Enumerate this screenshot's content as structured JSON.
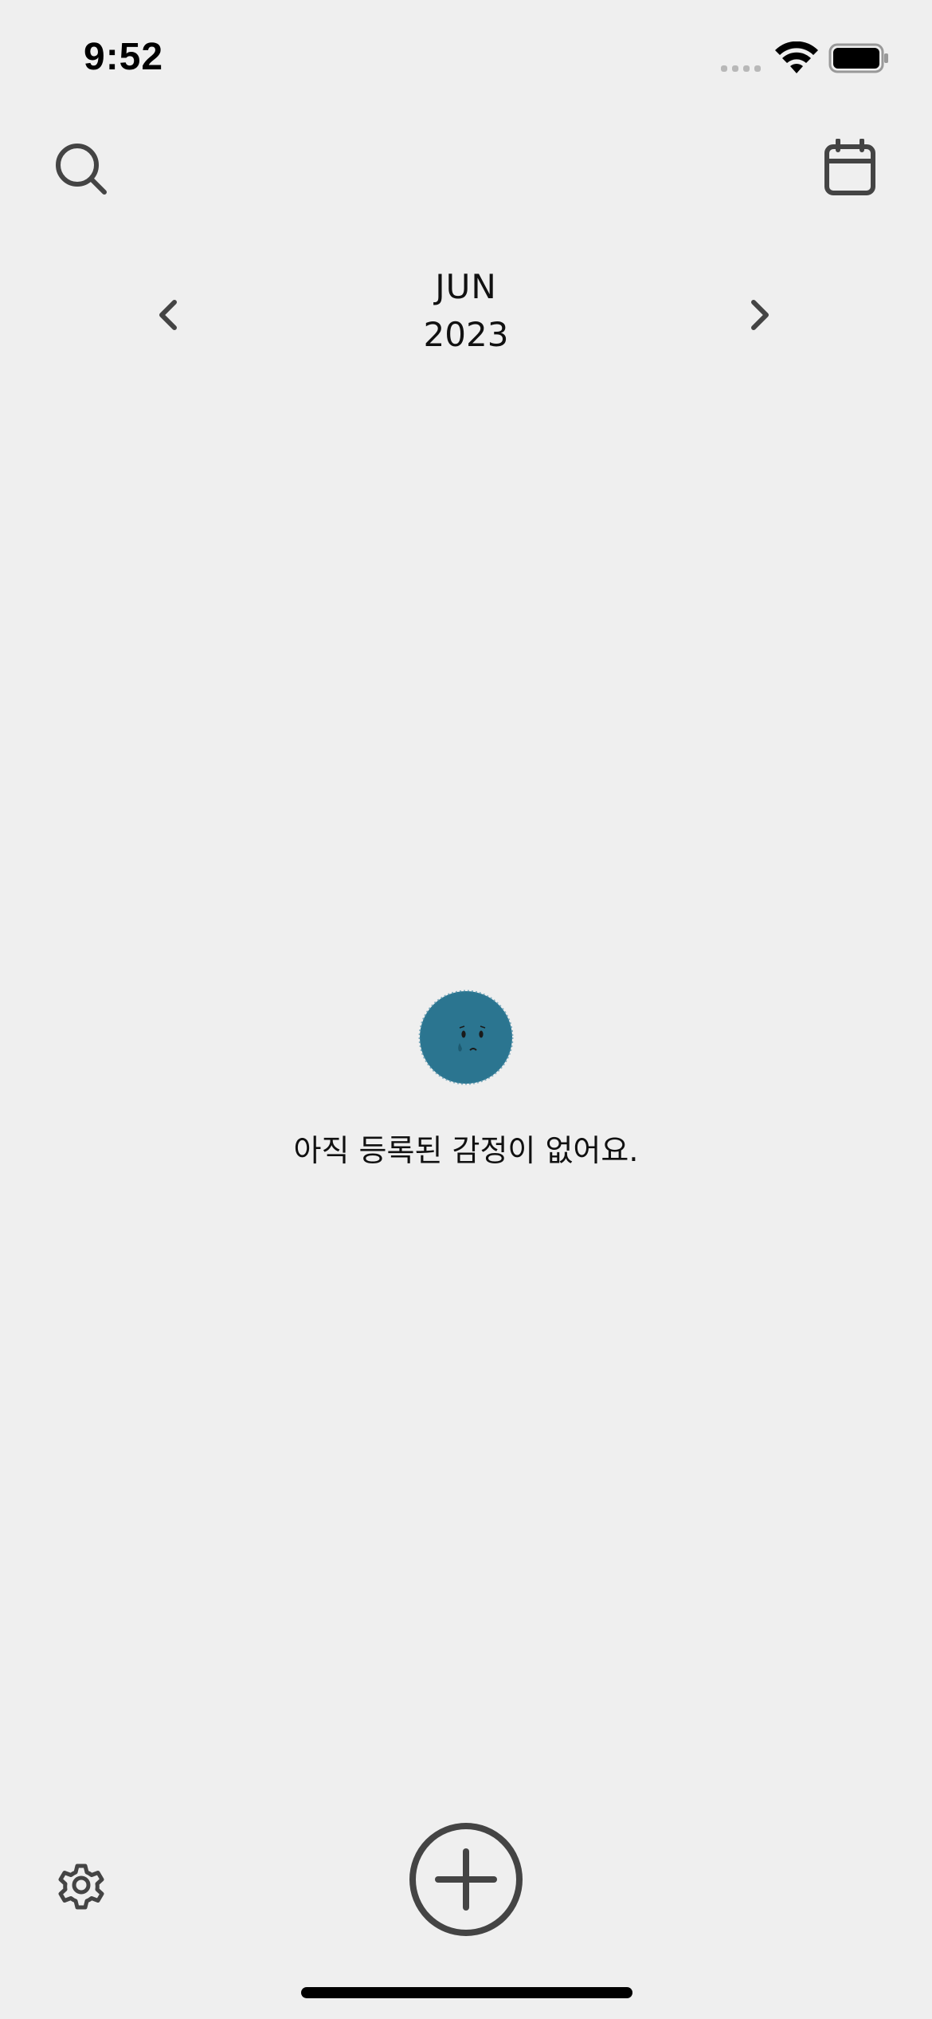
{
  "status_bar": {
    "time": "9:52"
  },
  "header": {
    "search_icon": "search-icon",
    "calendar_icon": "calendar-icon"
  },
  "month_nav": {
    "month": "JUN",
    "year": "2023",
    "prev_icon": "chevron-left-icon",
    "next_icon": "chevron-right-icon"
  },
  "empty_state": {
    "mascot": "sad-face-mascot",
    "mascot_color": "#2b7590",
    "message": "아직 등록된 감정이 없어요."
  },
  "bottom_bar": {
    "settings_icon": "gear-icon",
    "add_icon": "plus-circle-icon"
  },
  "colors": {
    "background": "#efefef",
    "icon": "#444444",
    "text": "#111111"
  }
}
